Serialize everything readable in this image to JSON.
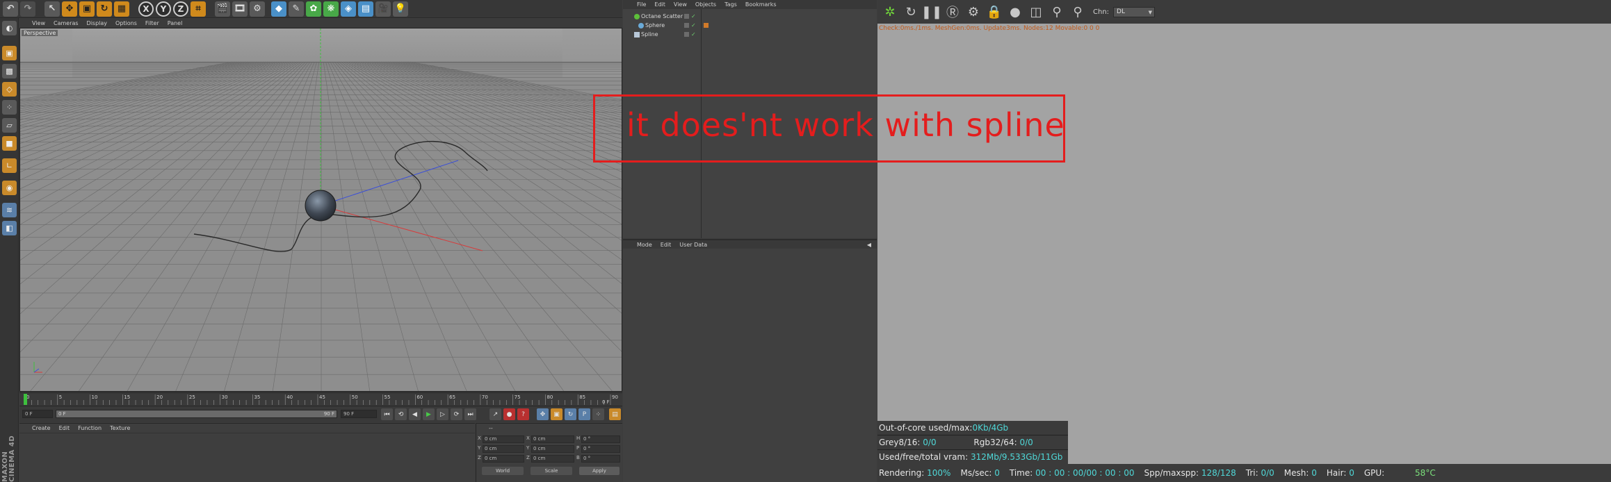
{
  "toolbar": {
    "axis_x": "X",
    "axis_y": "Y",
    "axis_z": "Z"
  },
  "viewport": {
    "menu": [
      "View",
      "Cameras",
      "Display",
      "Options",
      "Filter",
      "Panel"
    ],
    "view_label": "Perspective"
  },
  "timeline": {
    "frames": [
      "0",
      "5",
      "10",
      "15",
      "20",
      "25",
      "30",
      "35",
      "40",
      "45",
      "50",
      "55",
      "60",
      "65",
      "70",
      "75",
      "80",
      "85",
      "90"
    ],
    "current_frame": "0 F",
    "start_frame": "0 F",
    "range_start": "0 F",
    "range_end": "90 F",
    "end_frame": "90 F"
  },
  "material_panel": {
    "menu": [
      "Create",
      "Edit",
      "Function",
      "Texture"
    ]
  },
  "coord_panel": {
    "header": "--",
    "rows": [
      {
        "a": "X",
        "av": "0 cm",
        "b": "X",
        "bv": "0 cm",
        "c": "H",
        "cv": "0 °"
      },
      {
        "a": "Y",
        "av": "0 cm",
        "b": "Y",
        "bv": "0 cm",
        "c": "P",
        "cv": "0 °"
      },
      {
        "a": "Z",
        "av": "0 cm",
        "b": "Z",
        "bv": "0 cm",
        "c": "B",
        "cv": "0 °"
      }
    ],
    "mode_world": "World",
    "mode_scale": "Scale",
    "apply_label": "Apply"
  },
  "object_manager": {
    "menu": [
      "File",
      "Edit",
      "View",
      "Objects",
      "Tags",
      "Bookmarks"
    ],
    "objects": [
      {
        "name": "Octane Scatter"
      },
      {
        "name": "Sphere"
      },
      {
        "name": "Spline"
      }
    ]
  },
  "attributes": {
    "menu": [
      "Mode",
      "Edit",
      "User Data"
    ]
  },
  "octane": {
    "chn_label": "Chn:",
    "chn_value": "DL",
    "status": "Check:0ms./1ms. MeshGen:0ms. Update3ms. Nodes:12 Movable:0  0 0",
    "info": {
      "ooc_label": "Out-of-core used/max:",
      "ooc_value": "0Kb/4Gb",
      "grey_label": "Grey8/16:",
      "grey_value": "0/0",
      "rgb_label": "Rgb32/64:",
      "rgb_value": "0/0",
      "vram_label": "Used/free/total vram:",
      "vram_value": "312Mb/9.533Gb/11Gb"
    },
    "bar": {
      "rendering_label": "Rendering:",
      "rendering_value": "100%",
      "ms_label": "Ms/sec:",
      "ms_value": "0",
      "time_label": "Time:",
      "time_value": "00 : 00 : 00/00 : 00 : 00",
      "spp_label": "Spp/maxspp:",
      "spp_value": "128/128",
      "tri_label": "Tri:",
      "tri_value": "0/0",
      "mesh_label": "Mesh:",
      "mesh_value": "0",
      "hair_label": "Hair:",
      "hair_value": "0",
      "gpu_label": "GPU:",
      "gpu_value": "58°C"
    }
  },
  "annotation": {
    "text": "it does'nt work with spline",
    "color": "#e41d1d"
  }
}
